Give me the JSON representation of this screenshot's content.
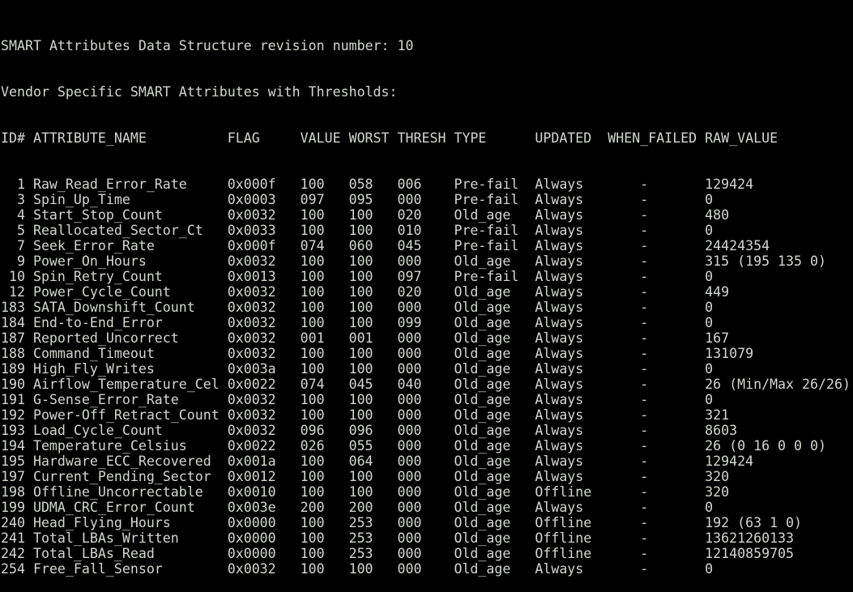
{
  "header": {
    "line1": "SMART Attributes Data Structure revision number: 10",
    "line2": "Vendor Specific SMART Attributes with Thresholds:"
  },
  "columns": {
    "id": "ID#",
    "name": "ATTRIBUTE_NAME",
    "flag": "FLAG",
    "value": "VALUE",
    "worst": "WORST",
    "thresh": "THRESH",
    "type": "TYPE",
    "updated": "UPDATED",
    "when_failed": "WHEN_FAILED",
    "raw_value": "RAW_VALUE"
  },
  "rows": [
    {
      "id": "1",
      "name": "Raw_Read_Error_Rate",
      "flag": "0x000f",
      "value": "100",
      "worst": "058",
      "thresh": "006",
      "type": "Pre-fail",
      "updated": "Always",
      "when_failed": "-",
      "raw": "129424"
    },
    {
      "id": "3",
      "name": "Spin_Up_Time",
      "flag": "0x0003",
      "value": "097",
      "worst": "095",
      "thresh": "000",
      "type": "Pre-fail",
      "updated": "Always",
      "when_failed": "-",
      "raw": "0"
    },
    {
      "id": "4",
      "name": "Start_Stop_Count",
      "flag": "0x0032",
      "value": "100",
      "worst": "100",
      "thresh": "020",
      "type": "Old_age",
      "updated": "Always",
      "when_failed": "-",
      "raw": "480"
    },
    {
      "id": "5",
      "name": "Reallocated_Sector_Ct",
      "flag": "0x0033",
      "value": "100",
      "worst": "100",
      "thresh": "010",
      "type": "Pre-fail",
      "updated": "Always",
      "when_failed": "-",
      "raw": "0"
    },
    {
      "id": "7",
      "name": "Seek_Error_Rate",
      "flag": "0x000f",
      "value": "074",
      "worst": "060",
      "thresh": "045",
      "type": "Pre-fail",
      "updated": "Always",
      "when_failed": "-",
      "raw": "24424354"
    },
    {
      "id": "9",
      "name": "Power_On_Hours",
      "flag": "0x0032",
      "value": "100",
      "worst": "100",
      "thresh": "000",
      "type": "Old_age",
      "updated": "Always",
      "when_failed": "-",
      "raw": "315 (195 135 0)"
    },
    {
      "id": "10",
      "name": "Spin_Retry_Count",
      "flag": "0x0013",
      "value": "100",
      "worst": "100",
      "thresh": "097",
      "type": "Pre-fail",
      "updated": "Always",
      "when_failed": "-",
      "raw": "0"
    },
    {
      "id": "12",
      "name": "Power_Cycle_Count",
      "flag": "0x0032",
      "value": "100",
      "worst": "100",
      "thresh": "020",
      "type": "Old_age",
      "updated": "Always",
      "when_failed": "-",
      "raw": "449"
    },
    {
      "id": "183",
      "name": "SATA_Downshift_Count",
      "flag": "0x0032",
      "value": "100",
      "worst": "100",
      "thresh": "000",
      "type": "Old_age",
      "updated": "Always",
      "when_failed": "-",
      "raw": "0"
    },
    {
      "id": "184",
      "name": "End-to-End_Error",
      "flag": "0x0032",
      "value": "100",
      "worst": "100",
      "thresh": "099",
      "type": "Old_age",
      "updated": "Always",
      "when_failed": "-",
      "raw": "0"
    },
    {
      "id": "187",
      "name": "Reported_Uncorrect",
      "flag": "0x0032",
      "value": "001",
      "worst": "001",
      "thresh": "000",
      "type": "Old_age",
      "updated": "Always",
      "when_failed": "-",
      "raw": "167"
    },
    {
      "id": "188",
      "name": "Command_Timeout",
      "flag": "0x0032",
      "value": "100",
      "worst": "100",
      "thresh": "000",
      "type": "Old_age",
      "updated": "Always",
      "when_failed": "-",
      "raw": "131079"
    },
    {
      "id": "189",
      "name": "High_Fly_Writes",
      "flag": "0x003a",
      "value": "100",
      "worst": "100",
      "thresh": "000",
      "type": "Old_age",
      "updated": "Always",
      "when_failed": "-",
      "raw": "0"
    },
    {
      "id": "190",
      "name": "Airflow_Temperature_Cel",
      "flag": "0x0022",
      "value": "074",
      "worst": "045",
      "thresh": "040",
      "type": "Old_age",
      "updated": "Always",
      "when_failed": "-",
      "raw": "26 (Min/Max 26/26)"
    },
    {
      "id": "191",
      "name": "G-Sense_Error_Rate",
      "flag": "0x0032",
      "value": "100",
      "worst": "100",
      "thresh": "000",
      "type": "Old_age",
      "updated": "Always",
      "when_failed": "-",
      "raw": "0"
    },
    {
      "id": "192",
      "name": "Power-Off_Retract_Count",
      "flag": "0x0032",
      "value": "100",
      "worst": "100",
      "thresh": "000",
      "type": "Old_age",
      "updated": "Always",
      "when_failed": "-",
      "raw": "321"
    },
    {
      "id": "193",
      "name": "Load_Cycle_Count",
      "flag": "0x0032",
      "value": "096",
      "worst": "096",
      "thresh": "000",
      "type": "Old_age",
      "updated": "Always",
      "when_failed": "-",
      "raw": "8603"
    },
    {
      "id": "194",
      "name": "Temperature_Celsius",
      "flag": "0x0022",
      "value": "026",
      "worst": "055",
      "thresh": "000",
      "type": "Old_age",
      "updated": "Always",
      "when_failed": "-",
      "raw": "26 (0 16 0 0 0)"
    },
    {
      "id": "195",
      "name": "Hardware_ECC_Recovered",
      "flag": "0x001a",
      "value": "100",
      "worst": "064",
      "thresh": "000",
      "type": "Old_age",
      "updated": "Always",
      "when_failed": "-",
      "raw": "129424"
    },
    {
      "id": "197",
      "name": "Current_Pending_Sector",
      "flag": "0x0012",
      "value": "100",
      "worst": "100",
      "thresh": "000",
      "type": "Old_age",
      "updated": "Always",
      "when_failed": "-",
      "raw": "320"
    },
    {
      "id": "198",
      "name": "Offline_Uncorrectable",
      "flag": "0x0010",
      "value": "100",
      "worst": "100",
      "thresh": "000",
      "type": "Old_age",
      "updated": "Offline",
      "when_failed": "-",
      "raw": "320"
    },
    {
      "id": "199",
      "name": "UDMA_CRC_Error_Count",
      "flag": "0x003e",
      "value": "200",
      "worst": "200",
      "thresh": "000",
      "type": "Old_age",
      "updated": "Always",
      "when_failed": "-",
      "raw": "0"
    },
    {
      "id": "240",
      "name": "Head_Flying_Hours",
      "flag": "0x0000",
      "value": "100",
      "worst": "253",
      "thresh": "000",
      "type": "Old_age",
      "updated": "Offline",
      "when_failed": "-",
      "raw": "192 (63 1 0)"
    },
    {
      "id": "241",
      "name": "Total_LBAs_Written",
      "flag": "0x0000",
      "value": "100",
      "worst": "253",
      "thresh": "000",
      "type": "Old_age",
      "updated": "Offline",
      "when_failed": "-",
      "raw": "13621260133"
    },
    {
      "id": "242",
      "name": "Total_LBAs_Read",
      "flag": "0x0000",
      "value": "100",
      "worst": "253",
      "thresh": "000",
      "type": "Old_age",
      "updated": "Offline",
      "when_failed": "-",
      "raw": "12140859705"
    },
    {
      "id": "254",
      "name": "Free_Fall_Sensor",
      "flag": "0x0032",
      "value": "100",
      "worst": "100",
      "thresh": "000",
      "type": "Old_age",
      "updated": "Always",
      "when_failed": "-",
      "raw": "0"
    }
  ]
}
